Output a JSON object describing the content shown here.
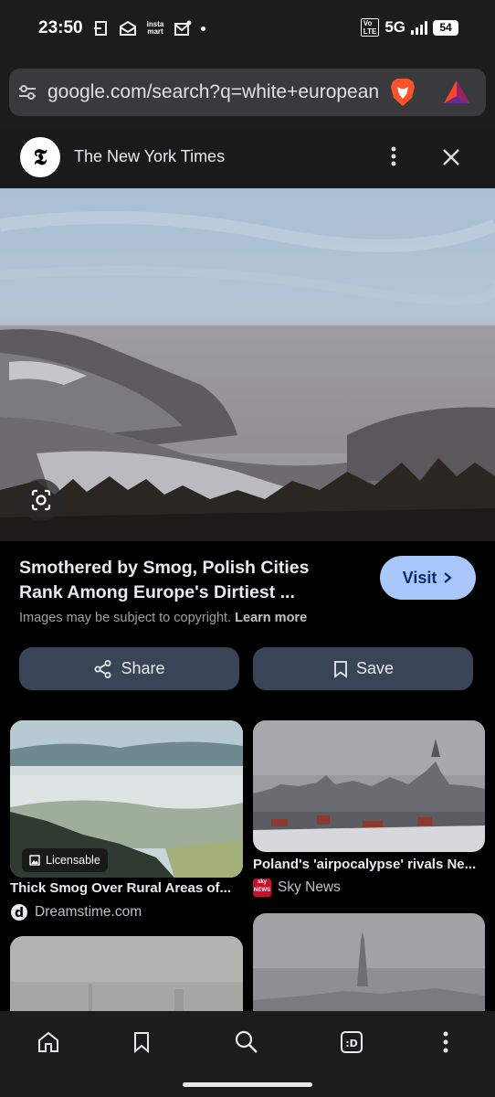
{
  "status_bar": {
    "time": "23:50",
    "insta_label": "insta\nmart",
    "volte": "Vo\nLTE",
    "network": "5G",
    "battery": "54"
  },
  "browser": {
    "url": "google.com/search?q=white+european"
  },
  "source": {
    "logo_letter": "𝕿",
    "name": "The New York Times"
  },
  "image_result": {
    "title": "Smothered by Smog, Polish Cities Rank Among Europe's Dirtiest ...",
    "visit_label": "Visit",
    "copyright_text": "Images may be subject to copyright.",
    "learn_more": "Learn more",
    "share_label": "Share",
    "save_label": "Save"
  },
  "related": [
    {
      "title": "Thick Smog Over Rural Areas of...",
      "source": "Dreamstime.com",
      "badge": "Licensable"
    },
    {
      "title": "Poland's 'airpocalypse' rivals Ne...",
      "source": "Sky News",
      "source_logo": "sky\nNEWS"
    }
  ],
  "colors": {
    "accent_button": "#a8c7fa",
    "action_button": "#394457",
    "background": "#000000"
  }
}
